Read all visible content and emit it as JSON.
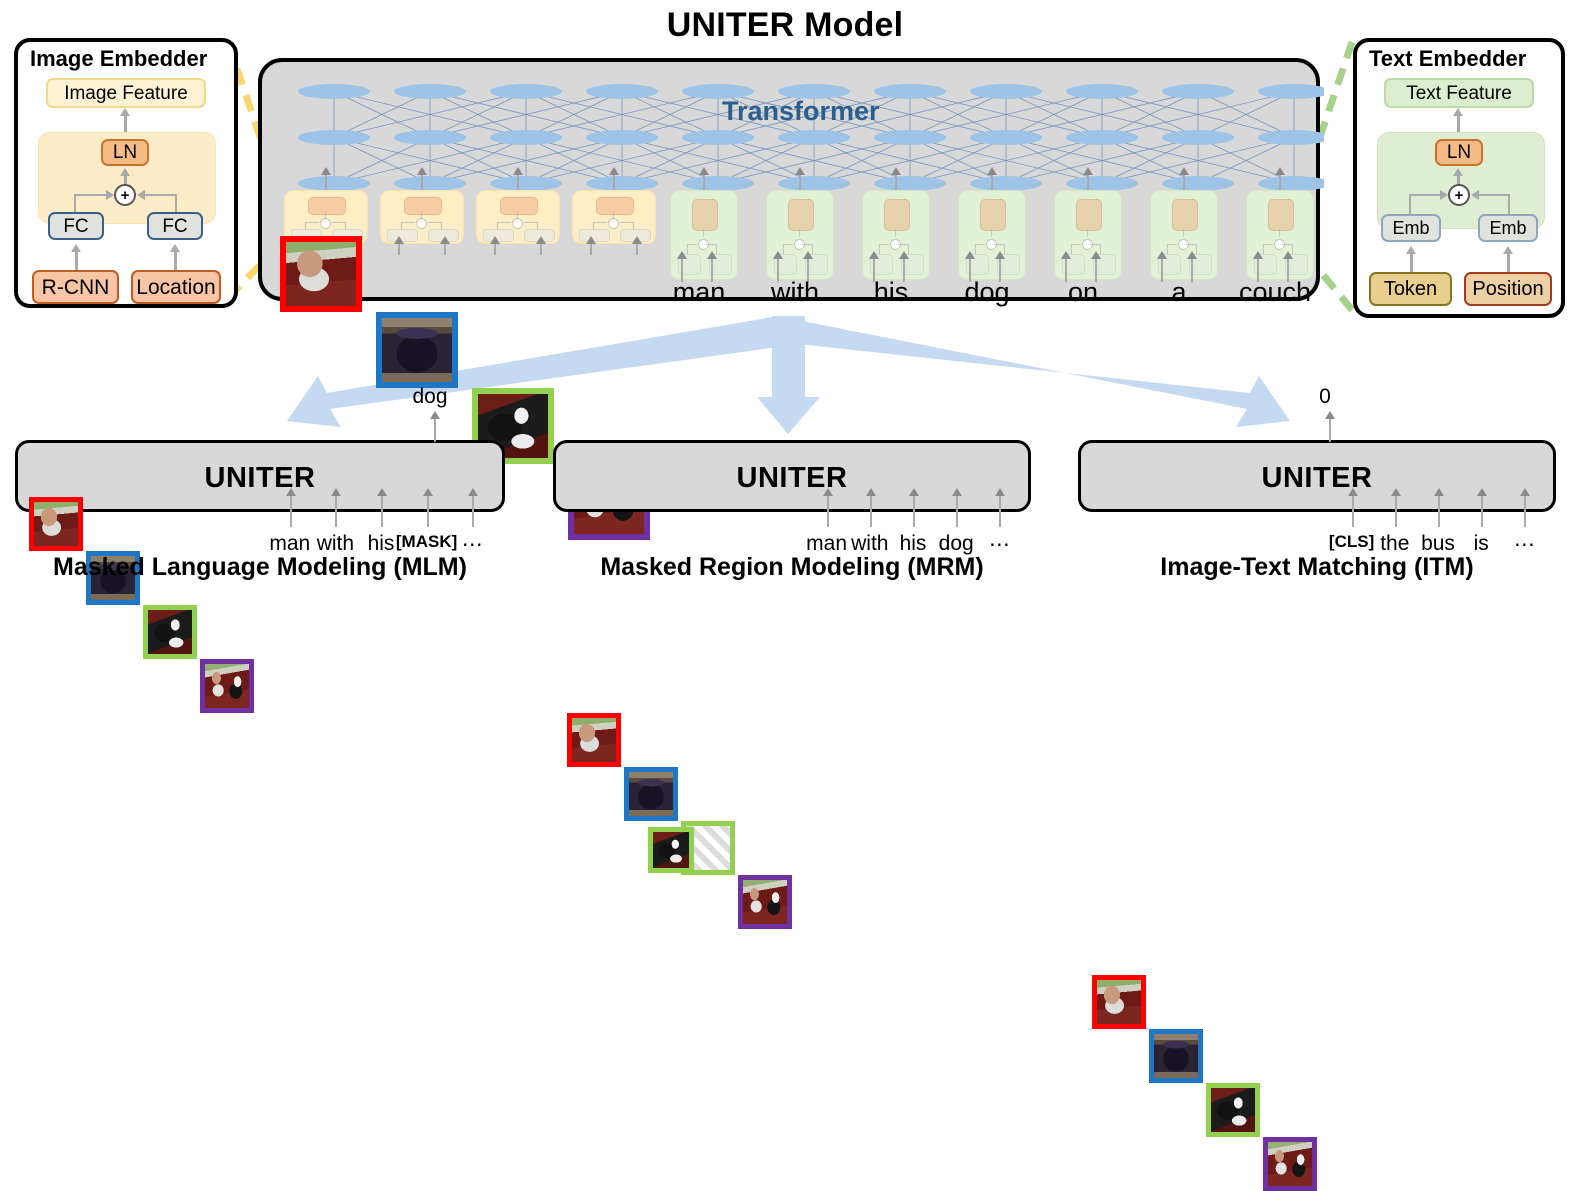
{
  "title": "UNITER Model",
  "colors": {
    "transformer_text": "#2a5f8f",
    "node": "#9dc3e6",
    "big_arrow": "#c5d9f1",
    "image_dash": "#f5d76e",
    "text_dash": "#a8d08d",
    "region_1": "#ff0000",
    "region_2": "#1f77c4",
    "region_3": "#92d050",
    "region_4": "#7030a0"
  },
  "image_embedder": {
    "title": "Image Embedder",
    "feature_label": "Image Feature",
    "ln_label": "LN",
    "plus_label": "+",
    "fc_left_label": "FC",
    "fc_right_label": "FC",
    "input_left_label": "R-CNN",
    "input_right_label": "Location"
  },
  "text_embedder": {
    "title": "Text Embedder",
    "feature_label": "Text Feature",
    "ln_label": "LN",
    "plus_label": "+",
    "emb_left_label": "Emb",
    "emb_right_label": "Emb",
    "input_left_label": "Token",
    "input_right_label": "Position"
  },
  "transformer": {
    "label": "Transformer",
    "image_cells": 4,
    "text_cells": 7,
    "node_rows": 3,
    "node_cols": 11
  },
  "regions": [
    {
      "name": "man-on-couch",
      "border": "#ff0000"
    },
    {
      "name": "dark-cup",
      "border": "#1f77c4"
    },
    {
      "name": "dog-on-couch",
      "border": "#92d050"
    },
    {
      "name": "man-with-dog",
      "border": "#7030a0"
    }
  ],
  "caption_tokens": [
    "man",
    "with",
    "his",
    "dog",
    "on",
    "a",
    "couch"
  ],
  "tasks": [
    {
      "id": "mlm",
      "uniter_label": "UNITER",
      "caption": "Masked Language Modeling (MLM)",
      "output": "dog",
      "output_type": "word",
      "tokens": [
        "man",
        "with",
        "his",
        "[MASK]",
        "⋯"
      ],
      "bold_tokens": [
        false,
        false,
        false,
        true,
        false
      ],
      "regions": [
        "#ff0000",
        "#1f77c4",
        "#92d050",
        "#7030a0"
      ],
      "masked_region_index": -1
    },
    {
      "id": "mrm",
      "uniter_label": "UNITER",
      "caption": "Masked Region Modeling (MRM)",
      "output": "",
      "output_type": "image",
      "tokens": [
        "man",
        "with",
        "his",
        "dog",
        "⋯"
      ],
      "bold_tokens": [
        false,
        false,
        false,
        false,
        false
      ],
      "regions": [
        "#ff0000",
        "#1f77c4",
        "#92d050",
        "#7030a0"
      ],
      "masked_region_index": 2
    },
    {
      "id": "itm",
      "uniter_label": "UNITER",
      "caption": "Image-Text Matching (ITM)",
      "output": "0",
      "output_type": "word",
      "tokens": [
        "[CLS]",
        "the",
        "bus",
        "is",
        "⋯"
      ],
      "bold_tokens": [
        true,
        false,
        false,
        false,
        false
      ],
      "regions": [
        "#ff0000",
        "#1f77c4",
        "#92d050",
        "#7030a0"
      ],
      "masked_region_index": -1
    }
  ]
}
